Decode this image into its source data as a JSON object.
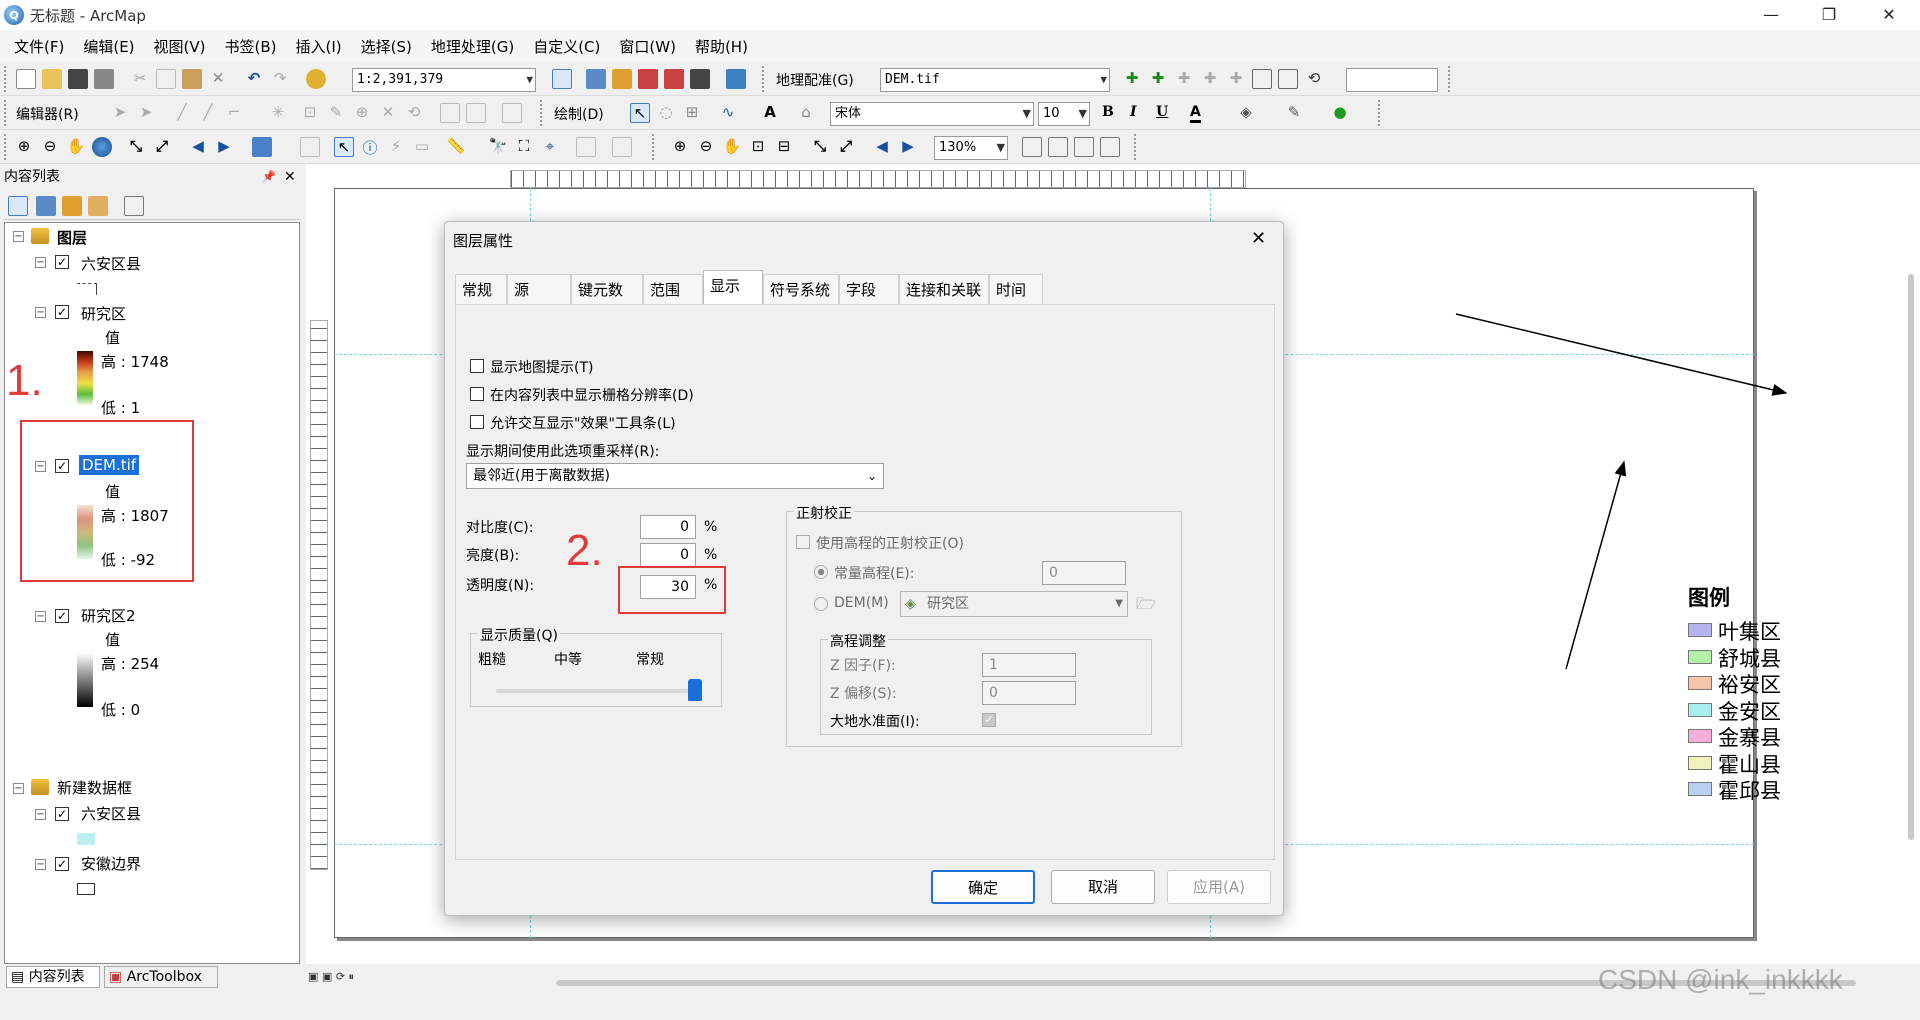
{
  "window": {
    "title": "无标题 - ArcMap",
    "min": "—",
    "max": "❐",
    "close": "✕"
  },
  "menu": [
    "文件(F)",
    "编辑(E)",
    "视图(V)",
    "书签(B)",
    "插入(I)",
    "选择(S)",
    "地理处理(G)",
    "自定义(C)",
    "窗口(W)",
    "帮助(H)"
  ],
  "toolbar": {
    "scale": "1:2,391,379",
    "georef": "地理配准(G)",
    "georef_layer": "DEM.tif",
    "editor": "编辑器(R)",
    "draw": "绘制(D)",
    "font": "宋体",
    "font_size": "10",
    "bold": "B",
    "italic": "I",
    "underline": "U",
    "text_a": "A",
    "zoom": "130%"
  },
  "toc": {
    "title": "内容列表",
    "pin": "📌",
    "close": "✕",
    "layers_group": "图层",
    "liuan": "六安区县",
    "study": {
      "name": "研究区",
      "value": "值",
      "high": "高 : 1748",
      "low": "低 : 1"
    },
    "dem": {
      "name": "DEM.tif",
      "value": "值",
      "high": "高 : 1807",
      "low": "低 : -92"
    },
    "study2": {
      "name": "研究区2",
      "value": "值",
      "high": "高 : 254",
      "low": "低 : 0"
    },
    "new_frame": "新建数据框",
    "liuan2": "六安区县",
    "anhui": "安徽边界",
    "bottom_tabs": [
      "内容列表",
      "ArcToolbox"
    ]
  },
  "annotations": {
    "one": "1.",
    "two": "2."
  },
  "dialog": {
    "title": "图层属性",
    "close": "✕",
    "tabs": [
      "常规",
      "源",
      "键元数据",
      "范围",
      "显示",
      "符号系统",
      "字段",
      "连接和关联",
      "时间"
    ],
    "chk_maptips": "显示地图提示(T)",
    "chk_resolution": "在内容列表中显示栅格分辨率(D)",
    "chk_effects": "允许交互显示\"效果\"工具条(L)",
    "resample_label": "显示期间使用此选项重采样(R):",
    "resample_value": "最邻近(用于离散数据)",
    "contrast_label": "对比度(C):",
    "contrast_value": "0",
    "brightness_label": "亮度(B):",
    "brightness_value": "0",
    "transparency_label": "透明度(N):",
    "transparency_value": "30",
    "percent": "%",
    "quality_group": "显示质量(Q)",
    "quality_coarse": "粗糙",
    "quality_medium": "中等",
    "quality_normal": "常规",
    "ortho_group": "正射校正",
    "ortho_check": "使用高程的正射校正(O)",
    "const_elev": "常量高程(E):",
    "const_elev_value": "0",
    "dem_label": "DEM(M)",
    "dem_value": "研究区",
    "elev_adjust": "高程调整",
    "zfactor": "Z 因子(F):",
    "zfactor_value": "1",
    "zoffset": "Z 偏移(S):",
    "zoffset_value": "0",
    "geoid": "大地水准面(I):",
    "ok": "确定",
    "cancel": "取消",
    "apply": "应用(A)"
  },
  "legend": {
    "title": "图例",
    "items": [
      {
        "name": "叶集区",
        "color": "#b8b4f0"
      },
      {
        "name": "舒城县",
        "color": "#b4f0a8"
      },
      {
        "name": "裕安区",
        "color": "#f5c6a8"
      },
      {
        "name": "金安区",
        "color": "#a8eef0"
      },
      {
        "name": "金寨县",
        "color": "#f4b0d8"
      },
      {
        "name": "霍山县",
        "color": "#f0f4bc"
      },
      {
        "name": "霍邱县",
        "color": "#bcd0f4"
      }
    ]
  },
  "watermark": "CSDN @ink_inkkkk"
}
